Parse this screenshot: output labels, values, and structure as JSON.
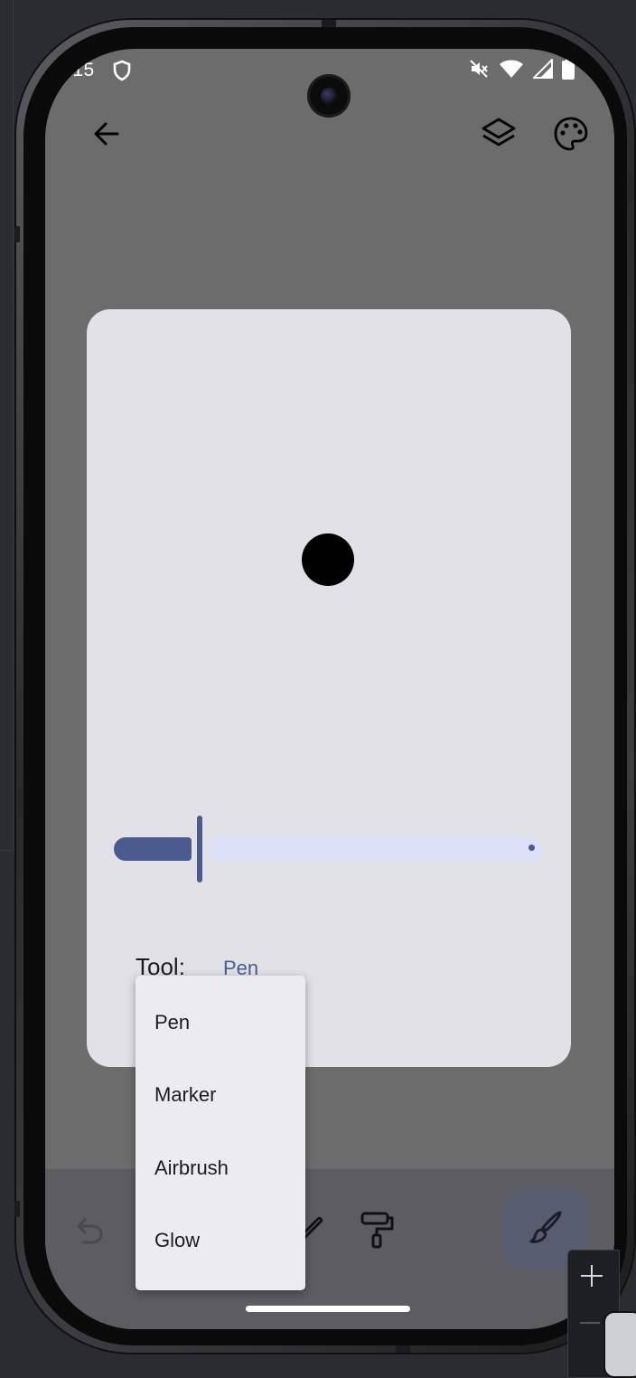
{
  "status_bar": {
    "time": ".15"
  },
  "app_bar": {
    "back_icon": "arrow-left-icon",
    "layers_icon": "layers-icon",
    "palette_icon": "palette-icon"
  },
  "dialog": {
    "preview_color": "#000000",
    "slider": {
      "value_fraction": 0.2
    },
    "tool_label": "Tool:",
    "tool_value": "Pen"
  },
  "tool_menu": {
    "items": [
      {
        "label": "Pen"
      },
      {
        "label": "Marker"
      },
      {
        "label": "Airbrush"
      },
      {
        "label": "Glow"
      }
    ]
  },
  "bottom_toolbar": {
    "undo_icon": "undo-icon",
    "pencil_icon": "pencil-icon",
    "paint_roller_icon": "paint-roller-icon",
    "brush_icon": "brush-icon"
  },
  "colors": {
    "accent": "#4b5b90",
    "scrim": "#6c6c6c",
    "card": "#e2e1e7",
    "menu": "#ecebf2"
  }
}
